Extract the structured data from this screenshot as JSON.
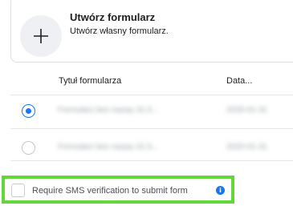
{
  "create_card": {
    "title": "Utwórz formularz",
    "subtitle": "Utwórz własny formularz.",
    "icon": "plus-icon"
  },
  "table": {
    "headers": [
      "Tytuł formularza",
      "Data..."
    ],
    "rows": [
      {
        "selected": true,
        "title": "Formularz bez nazwy 31.5...",
        "date": "2020-01-31"
      },
      {
        "selected": false,
        "title": "Formularz bez nazwy 31.5...",
        "date": "2020-01-31"
      }
    ]
  },
  "sms": {
    "label": "Require SMS verification to submit form",
    "checked": false,
    "info_icon": "i",
    "highlight_color": "#63d73a"
  },
  "colors": {
    "accent": "#1877f2",
    "border": "#dadde1"
  }
}
